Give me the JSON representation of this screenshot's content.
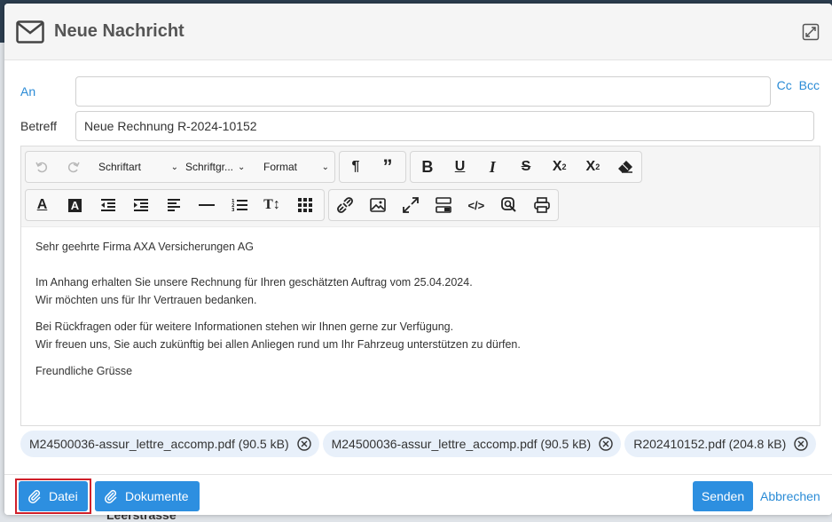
{
  "dialog": {
    "title": "Neue Nachricht"
  },
  "fields": {
    "to_label": "An",
    "to_value": "",
    "cc_label": "Cc",
    "bcc_label": "Bcc",
    "subject_label": "Betreff",
    "subject_value": "Neue Rechnung R-2024-10152"
  },
  "toolbar": {
    "font_label": "Schriftart",
    "fontsize_label": "Schriftgr...",
    "format_label": "Format",
    "bold": "B",
    "underline": "U",
    "italic": "I",
    "strike": "S"
  },
  "body": {
    "greeting": "Sehr geehrte Firma AXA Versicherungen AG",
    "line1": "Im Anhang erhalten Sie unsere Rechnung für Ihren geschätzten Auftrag vom 25.04.2024.",
    "line2": "Wir möchten uns für Ihr Vertrauen bedanken.",
    "line3": "Bei Rückfragen oder für weitere Informationen stehen wir Ihnen  gerne zur Verfügung.",
    "line4": "Wir freuen uns, Sie auch zukünftig bei allen Anliegen rund um Ihr Fahrzeug unterstützen zu dürfen.",
    "closing": "Freundliche Grüsse"
  },
  "attachments": [
    {
      "name": "M24500036-assur_lettre_accomp.pdf (90.5 kB)"
    },
    {
      "name": "M24500036-assur_lettre_accomp.pdf (90.5 kB)"
    },
    {
      "name": "R202410152.pdf (204.8 kB)"
    }
  ],
  "footer": {
    "file_button": "Datei",
    "documents_button": "Dokumente",
    "send_button": "Senden",
    "cancel_link": "Abbrechen"
  },
  "background": {
    "partial_text": "Leerstrasse"
  },
  "colors": {
    "accent": "#2d8fe0",
    "highlight": "#d0202a"
  }
}
